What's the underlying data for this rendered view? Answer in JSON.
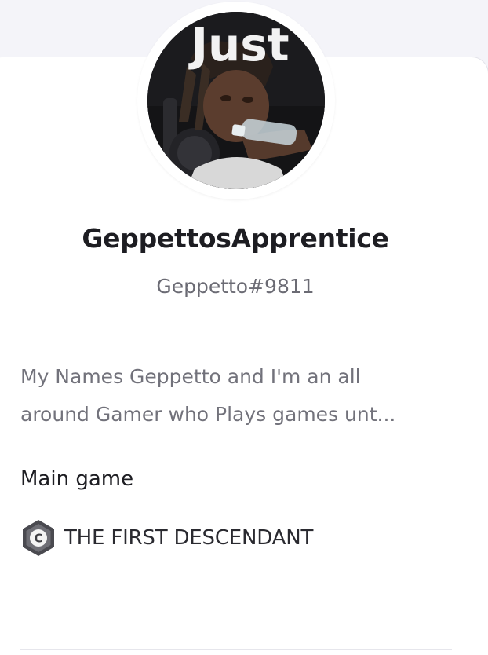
{
  "profile": {
    "username": "GeppettosApprentice",
    "tag": "Geppetto#9811",
    "avatar_overlay_text": "Just",
    "bio_lines": [
      "My Names Geppetto and I'm an all",
      "around Gamer who Plays games unt..."
    ]
  },
  "main_game": {
    "label": "Main game",
    "name": "THE FIRST DESCENDANT",
    "icon": "game-hexagon-icon",
    "icon_letter": "C"
  },
  "colors": {
    "background": "#f4f4f9",
    "card": "#ffffff",
    "username": "#1d1d22",
    "muted_text": "#72727b",
    "icon_gray": "#5a5a60"
  }
}
